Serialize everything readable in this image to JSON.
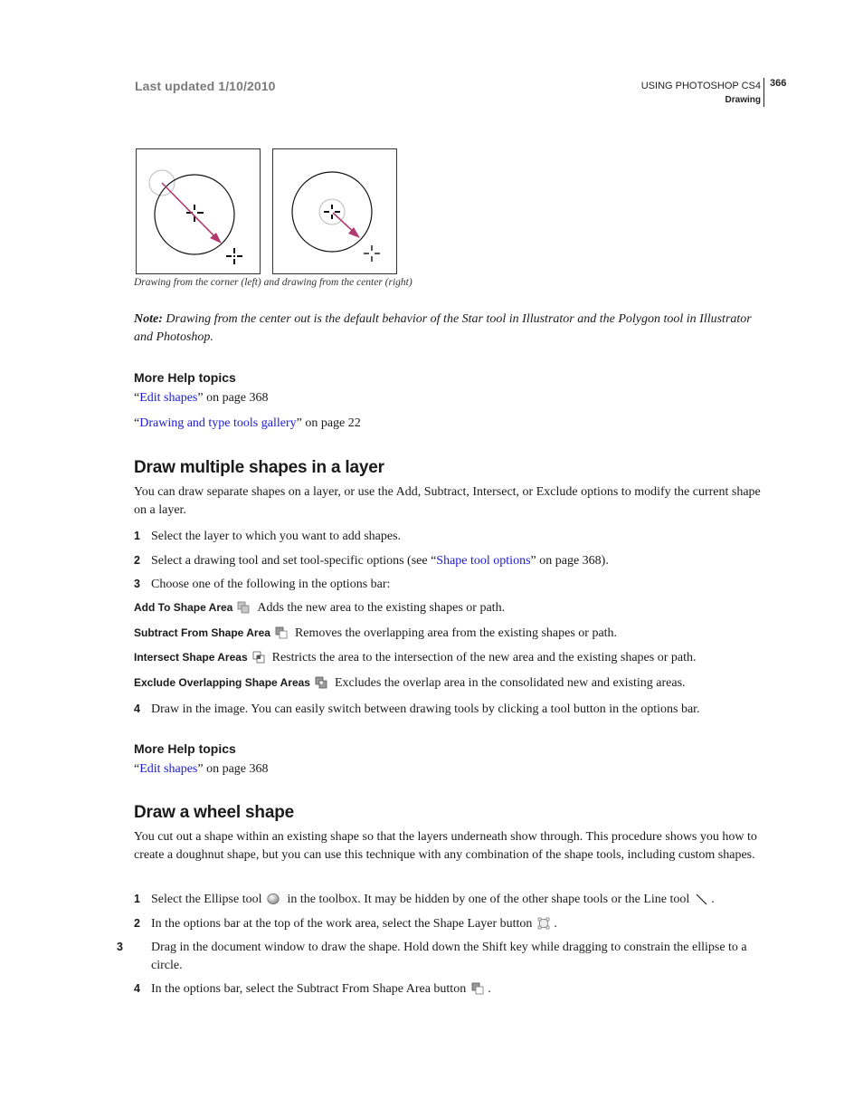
{
  "header": {
    "last_updated": "Last updated 1/10/2010",
    "book_title": "USING PHOTOSHOP CS4",
    "chapter": "Drawing",
    "page_number": "366"
  },
  "figure": {
    "caption": "Drawing from the corner (left) and drawing from the center (right)",
    "colors": {
      "arrow": "#b03a6e",
      "ghost_circle": "#bbbbbb",
      "shape": "#111111"
    }
  },
  "note": {
    "label": "Note:",
    "text": " Drawing from the center out is the default behavior of the Star tool in Illustrator and the Polygon tool in Illustrator and Photoshop."
  },
  "help_topics_1": {
    "title": "More Help topics",
    "links": [
      {
        "open": "“",
        "label": "Edit shapes",
        "close": "” on page 368"
      },
      {
        "open": "“",
        "label": "Drawing and type tools gallery",
        "close": "” on page 22"
      }
    ]
  },
  "section_multiple": {
    "title": "Draw multiple shapes in a layer",
    "intro": "You can draw separate shapes on a layer, or use the Add, Subtract, Intersect, or Exclude options to modify the current shape on a layer.",
    "steps": [
      {
        "num": "1",
        "text": "Select the layer to which you want to add shapes."
      },
      {
        "num": "2",
        "text_before": "Select a drawing tool and set tool-specific options (see “",
        "link": "Shape tool options",
        "text_after": "” on page 368)."
      },
      {
        "num": "3",
        "text": "Choose one of the following in the options bar:"
      }
    ],
    "options": [
      {
        "term": "Add To Shape Area",
        "icon": "add-to-shape-area-icon",
        "desc": "Adds the new area to the existing shapes or path."
      },
      {
        "term": "Subtract From Shape Area",
        "icon": "subtract-from-shape-area-icon",
        "desc": "Removes the overlapping area from the existing shapes or path."
      },
      {
        "term": "Intersect Shape Areas",
        "icon": "intersect-shape-areas-icon",
        "desc": "Restricts the area to the intersection of the new area and the existing shapes or path."
      },
      {
        "term": "Exclude Overlapping Shape Areas",
        "icon": "exclude-overlapping-shape-areas-icon",
        "desc": "Excludes the overlap area in the consolidated new and existing areas."
      }
    ],
    "step4": {
      "num": "4",
      "text": "Draw in the image. You can easily switch between drawing tools by clicking a tool button in the options bar."
    }
  },
  "help_topics_2": {
    "title": "More Help topics",
    "links": [
      {
        "open": "“",
        "label": "Edit shapes",
        "close": "” on page 368"
      }
    ]
  },
  "section_wheel": {
    "title": "Draw a wheel shape",
    "intro": "You cut out a shape within an existing shape so that the layers underneath show through. This procedure shows you how to create a doughnut shape, but you can use this technique with any combination of the shape tools, including custom shapes.",
    "steps": [
      {
        "num": "1",
        "text_a": "Select the Ellipse tool",
        "text_b": "in the toolbox. It may be hidden by one of the other shape tools or the Line tool",
        "text_c": "."
      },
      {
        "num": "2",
        "text_a": "In the options bar at the top of the work area, select the Shape Layer button",
        "text_c": "."
      },
      {
        "num": "3",
        "text": "Drag in the document window to draw the shape. Hold down the Shift key while dragging to constrain the ellipse to a circle."
      },
      {
        "num": "4",
        "text_a": "In the options bar, select the Subtract From Shape Area button",
        "text_c": "."
      }
    ]
  },
  "colors": {
    "link": "#1a1ad8",
    "header_gray": "#7a7a7a"
  }
}
